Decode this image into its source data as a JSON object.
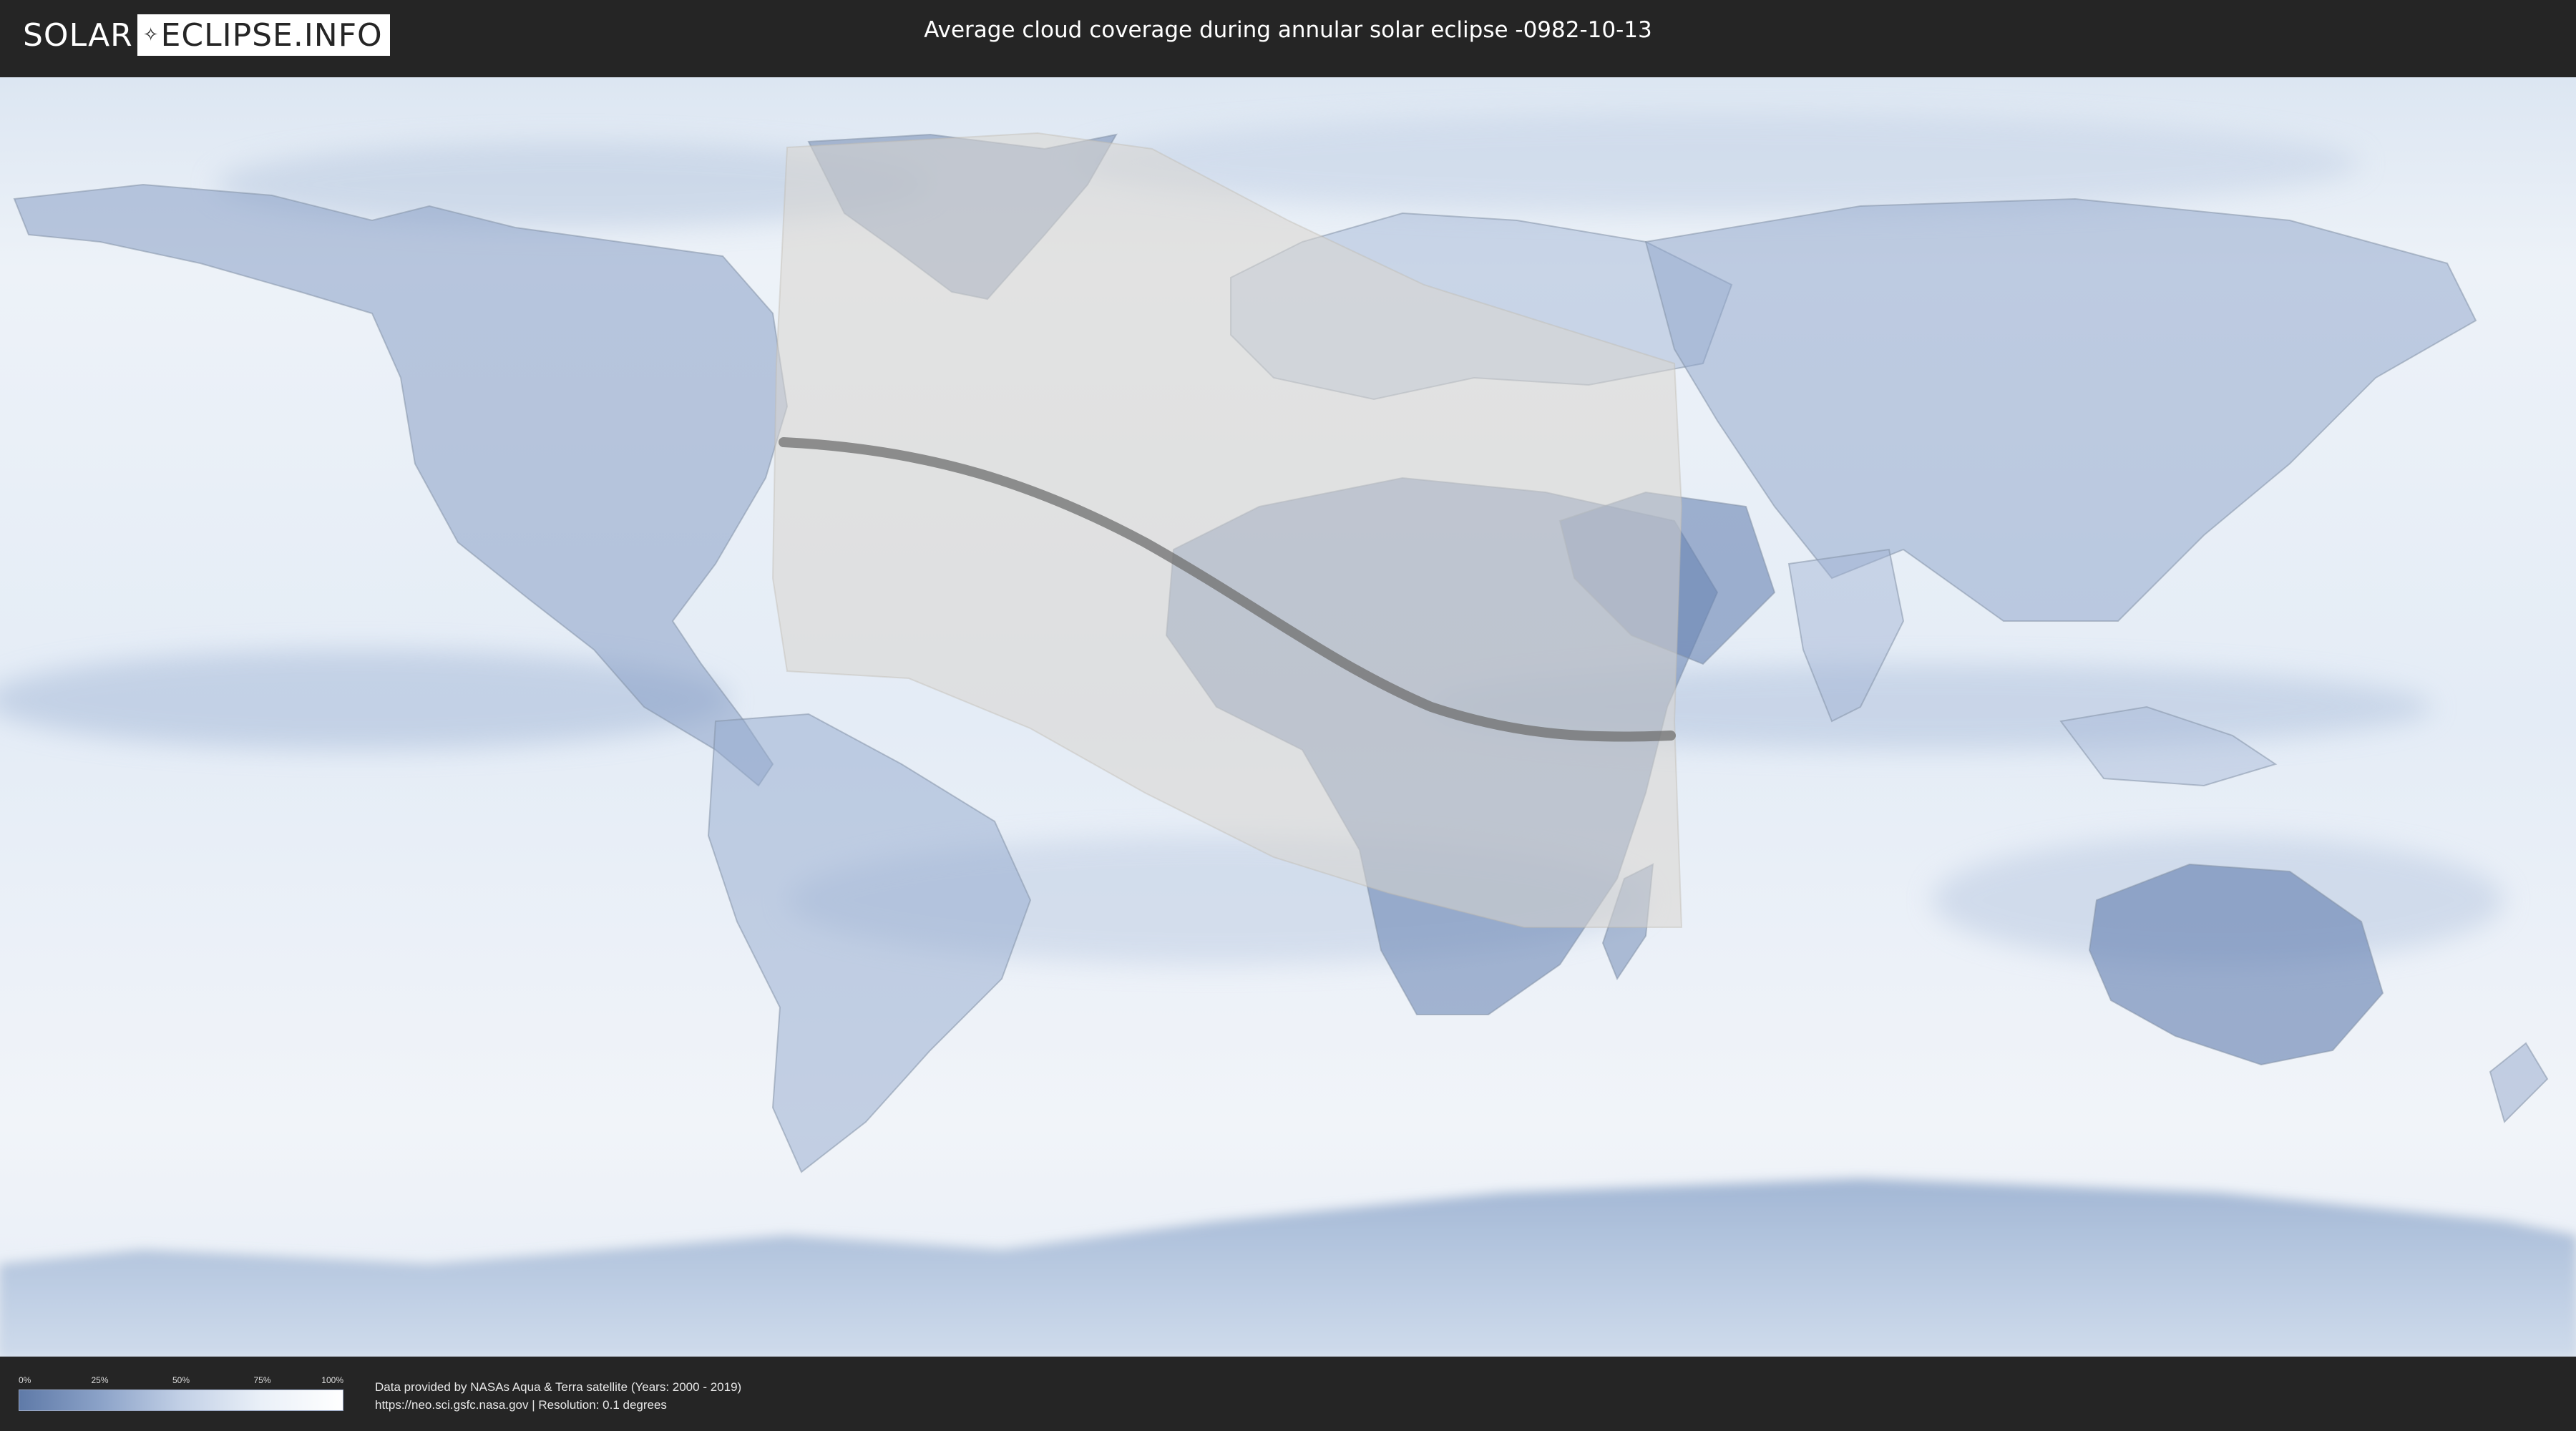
{
  "logo": {
    "left_text": "SOLAR",
    "right_text": "ECLIPSE.INFO"
  },
  "title": "Average cloud coverage during annular solar eclipse -0982-10-13",
  "legend": {
    "ticks": [
      "0%",
      "25%",
      "50%",
      "75%",
      "100%"
    ],
    "gradient": [
      "#5f7aa8",
      "#8ba2c8",
      "#c2d0e6",
      "#eaf0f8",
      "#ffffff"
    ]
  },
  "credits": {
    "line1": "Data provided by NASAs Aqua & Terra satellite (Years: 2000 - 2019)",
    "line2": "https://neo.sci.gsfc.nasa.gov | Resolution: 0.1 degrees"
  },
  "colors": {
    "clear_sky": "#5f7aa8",
    "cloudy": "#ffffff",
    "eclipse_zone": "#d9d6d0",
    "central_line": "#6f6f6f",
    "background": "#252525"
  }
}
